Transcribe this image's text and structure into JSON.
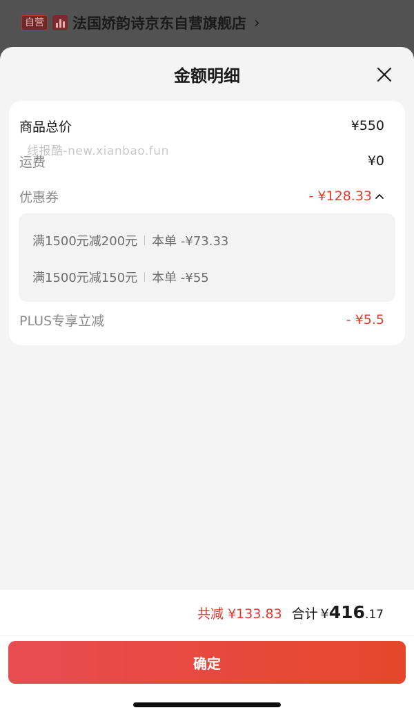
{
  "shop": {
    "badge": "自营",
    "name": "法国娇韵诗京东自营旗舰店",
    "chevron": "›"
  },
  "sheet": {
    "title": "金额明细"
  },
  "watermark": "线报酷-new.xianbao.fun",
  "rows": [
    {
      "label": "商品总价",
      "value": "¥550"
    },
    {
      "label": "运费",
      "value": "¥0"
    },
    {
      "label": "优惠券",
      "value": "- ¥128.33"
    },
    {
      "label": "PLUS专享立减",
      "value": "- ¥5.5"
    }
  ],
  "coupons": [
    {
      "rule": "满1500元减200元",
      "detail": "本单 -¥73.33"
    },
    {
      "rule": "满1500元减150元",
      "detail": "本单 -¥55"
    }
  ],
  "footer": {
    "saved": "共减 ¥133.83",
    "total_label": "合计",
    "currency": "¥",
    "total_int": "416",
    "total_dec": ".17",
    "confirm_label": "确定"
  },
  "colors": {
    "accent_red": "#e2392c",
    "button_gradient": [
      "#e84c52",
      "#e5472b"
    ]
  },
  "icons": {
    "close": "close-icon",
    "coupon_toggle": "chevron-up-icon",
    "shop_logo": "bar-chart-icon"
  }
}
